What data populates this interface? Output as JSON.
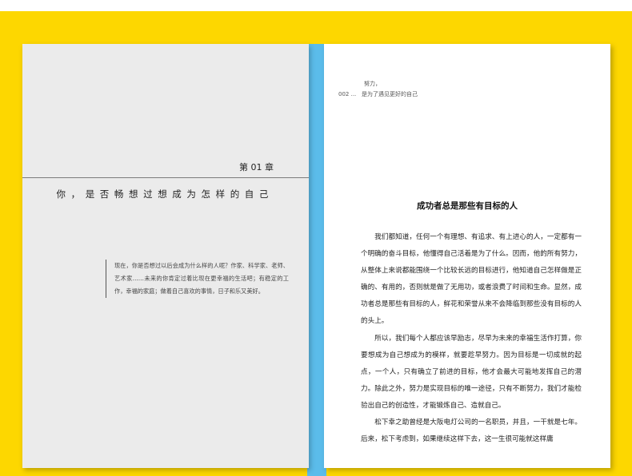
{
  "left_page": {
    "chapter_label": "第 01 章",
    "chapter_title": "你，是否畅想过想成为怎样的自己",
    "intro": "现在，你是否想过以后会成为什么样的人呢？作家、科学家、老师、艺术家……未来的你肯定过着比现在更幸福的生活吧；有稳定的工作，幸福的家庭；做着自己喜欢的事情，日子和乐又美好。"
  },
  "right_page": {
    "header": {
      "page_number": "002",
      "dots": "...",
      "line1": "努力，",
      "line2": "是为了遇见更好的自己"
    },
    "section_title": "成功者总是那些有目标的人",
    "paragraphs": [
      "我们都知道，任何一个有理想、有追求、有上进心的人，一定都有一个明确的奋斗目标，他懂得自己活着是为了什么。因而，他的所有努力，从整体上来说都能围绕一个比较长远的目标进行，他知道自己怎样做是正确的、有用的，否则就是做了无用功，或者浪费了时间和生命。显然，成功者总是那些有目标的人，鲜花和荣誉从来不会降临到那些没有目标的人的头上。",
      "所以，我们每个人都应该早励志，尽早为未来的幸福生活作打算，你要想成为自己想成为的模样，就要趁早努力。因为目标是一切成就的起点，一个人，只有确立了前进的目标，他才会最大可能地发挥自己的潜力。除此之外，努力是实现目标的唯一途径，只有不断努力，我们才能检验出自己的创造性，才能锻炼自己、造就自己。",
      "松下幸之助曾经是大阪电灯公司的一名职员，并且，一干就是七年。后来，松下考虑到，如果继续这样下去，这一生很可能就这样庸"
    ]
  }
}
